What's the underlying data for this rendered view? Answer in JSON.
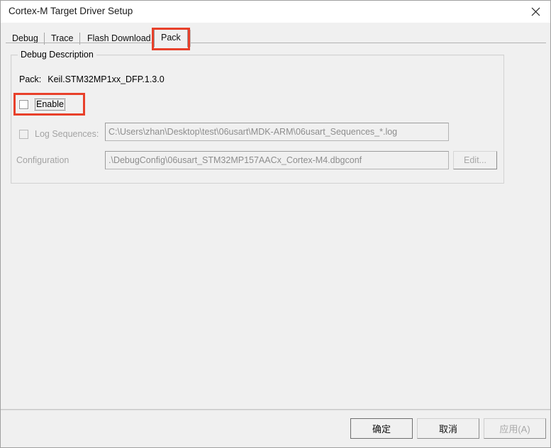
{
  "window": {
    "title": "Cortex-M Target Driver Setup",
    "close_icon": "close-icon"
  },
  "tabs": [
    {
      "label": "Debug",
      "selected": false
    },
    {
      "label": "Trace",
      "selected": false
    },
    {
      "label": "Flash Download",
      "selected": false
    },
    {
      "label": "Pack",
      "selected": true
    }
  ],
  "group": {
    "legend": "Debug Description",
    "pack": {
      "label": "Pack:",
      "value": "Keil.STM32MP1xx_DFP.1.3.0"
    },
    "enable": {
      "label": "Enable",
      "checked": false
    },
    "log_sequences": {
      "label": "Log Sequences:",
      "checked": false,
      "value": "C:\\Users\\zhan\\Desktop\\test\\06usart\\MDK-ARM\\06usart_Sequences_*.log"
    },
    "configuration": {
      "label": "Configuration",
      "value": ".\\DebugConfig\\06usart_STM32MP157AACx_Cortex-M4.dbgconf",
      "edit_label": "Edit..."
    }
  },
  "footer": {
    "ok_label": "确定",
    "cancel_label": "取消",
    "apply_label": "应用(A)"
  },
  "annotations": {
    "accent_color": "#e8402a",
    "pack_tab_highlight": "Pack",
    "enable_highlight": "Enable"
  }
}
